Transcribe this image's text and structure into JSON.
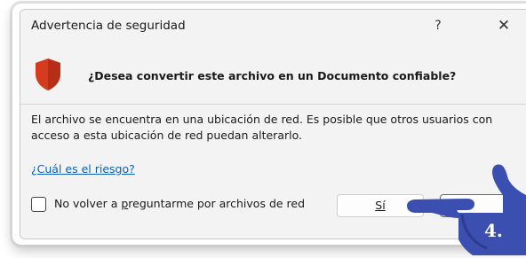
{
  "dialog": {
    "title": "Advertencia de seguridad",
    "help_label": "?",
    "close_label": "✕",
    "question": "¿Desea convertir este archivo en un Documento confiable?",
    "body": "El archivo se encuentra en una ubicación de red. Es posible que otros usuarios con acceso a esta ubicación de red puedan alterarlo.",
    "risk_link": "¿Cuál es el riesgo?",
    "checkbox_label": "No volver a preguntarme por archivos de red",
    "checkbox_checked": false,
    "yes_label": "Sí",
    "no_label": ""
  },
  "annotation": {
    "step": "4.",
    "icon": "pointing-hand-icon"
  },
  "colors": {
    "shield": "#d63b1f",
    "link": "#0b62b8",
    "hand": "#3a4fb0"
  }
}
